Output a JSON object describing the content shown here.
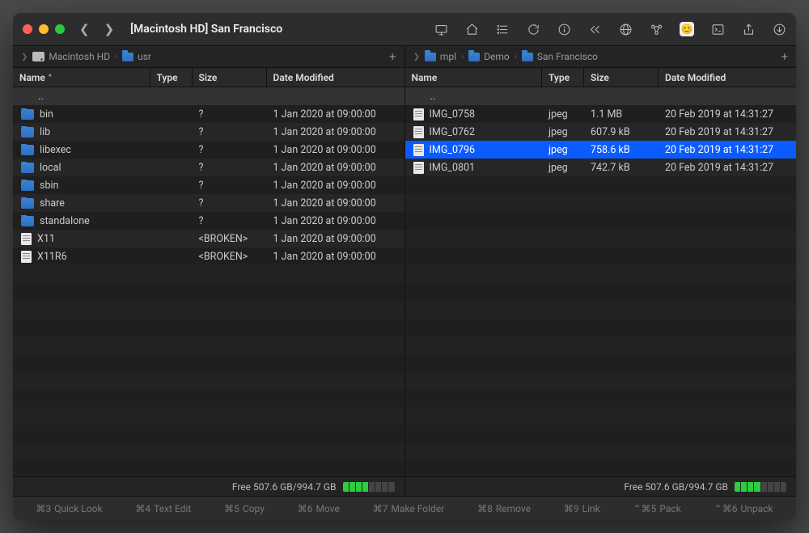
{
  "title": "[Macintosh HD] San Francisco",
  "breadcrumbs": {
    "left": [
      {
        "icon": "drive",
        "label": "Macintosh HD"
      },
      {
        "icon": "folder",
        "label": "usr"
      }
    ],
    "right": [
      {
        "icon": "folder",
        "label": "mpl"
      },
      {
        "icon": "folder",
        "label": "Demo"
      },
      {
        "icon": "folder",
        "label": "San Francisco"
      }
    ]
  },
  "columns": {
    "name": "Name",
    "type": "Type",
    "size": "Size",
    "date": "Date Modified"
  },
  "sort_indicator": "^",
  "parent_label": "..",
  "left_pane": {
    "rows": [
      {
        "icon": "folder",
        "name": "bin",
        "type": "",
        "size": "?",
        "date": "1 Jan 2020 at 09:00:00"
      },
      {
        "icon": "folder",
        "name": "lib",
        "type": "",
        "size": "?",
        "date": "1 Jan 2020 at 09:00:00"
      },
      {
        "icon": "folder",
        "name": "libexec",
        "type": "",
        "size": "?",
        "date": "1 Jan 2020 at 09:00:00"
      },
      {
        "icon": "folder",
        "name": "local",
        "type": "",
        "size": "?",
        "date": "1 Jan 2020 at 09:00:00"
      },
      {
        "icon": "folder",
        "name": "sbin",
        "type": "",
        "size": "?",
        "date": "1 Jan 2020 at 09:00:00"
      },
      {
        "icon": "folder",
        "name": "share",
        "type": "",
        "size": "?",
        "date": "1 Jan 2020 at 09:00:00"
      },
      {
        "icon": "folder",
        "name": "standalone",
        "type": "",
        "size": "?",
        "date": "1 Jan 2020 at 09:00:00"
      },
      {
        "icon": "file",
        "name": "X11",
        "type": "",
        "size": "<BROKEN>",
        "date": "1 Jan 2020 at 09:00:00"
      },
      {
        "icon": "file",
        "name": "X11R6",
        "type": "",
        "size": "<BROKEN>",
        "date": "1 Jan 2020 at 09:00:00"
      }
    ]
  },
  "right_pane": {
    "selected_index": 2,
    "rows": [
      {
        "icon": "file",
        "name": "IMG_0758",
        "type": "jpeg",
        "size": "1.1 MB",
        "date": "20 Feb 2019 at 14:31:27"
      },
      {
        "icon": "file",
        "name": "IMG_0762",
        "type": "jpeg",
        "size": "607.9 kB",
        "date": "20 Feb 2019 at 14:31:27"
      },
      {
        "icon": "file",
        "name": "IMG_0796",
        "type": "jpeg",
        "size": "758.6 kB",
        "date": "20 Feb 2019 at 14:31:27"
      },
      {
        "icon": "file",
        "name": "IMG_0801",
        "type": "jpeg",
        "size": "742.7 kB",
        "date": "20 Feb 2019 at 14:31:27"
      }
    ]
  },
  "status_left": {
    "text": "Free 507.6 GB/994.7 GB",
    "segments_on": 4,
    "segments_total": 8
  },
  "status_right": {
    "text": "Free 507.6 GB/994.7 GB",
    "segments_on": 4,
    "segments_total": 8
  },
  "footer": [
    {
      "key": "⌘3",
      "label": "Quick Look"
    },
    {
      "key": "⌘4",
      "label": "Text Edit"
    },
    {
      "key": "⌘5",
      "label": "Copy"
    },
    {
      "key": "⌘6",
      "label": "Move"
    },
    {
      "key": "⌘7",
      "label": "Make Folder"
    },
    {
      "key": "⌘8",
      "label": "Remove"
    },
    {
      "key": "⌘9",
      "label": "Link"
    },
    {
      "key": "⌃⌘5",
      "label": "Pack"
    },
    {
      "key": "⌃⌘6",
      "label": "Unpack"
    }
  ]
}
